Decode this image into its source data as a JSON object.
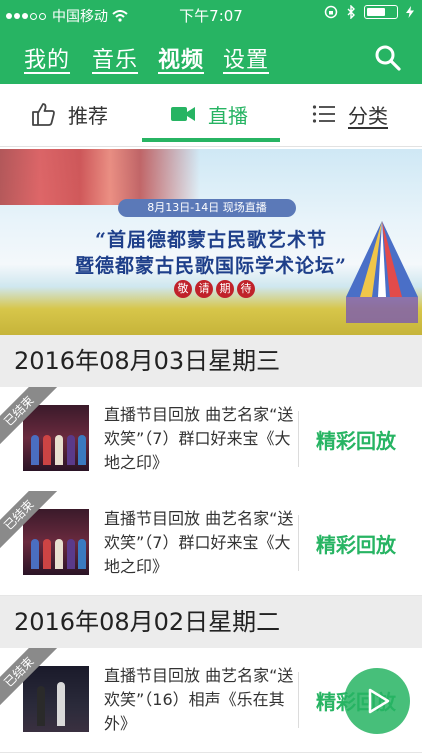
{
  "status": {
    "carrier": "中国移动",
    "time": "下午7:07"
  },
  "nav": {
    "tabs": [
      "我的",
      "音乐",
      "视频",
      "设置"
    ],
    "active": "视频"
  },
  "segments": [
    {
      "label": "推荐",
      "icon": "thumbs-up-icon"
    },
    {
      "label": "直播",
      "icon": "video-camera-icon"
    },
    {
      "label": "分类",
      "icon": "list-icon"
    }
  ],
  "banner": {
    "date": "8月13日-14日 现场直播",
    "line1": "“首届德都蒙古民歌艺术节",
    "line2": "暨德都蒙古民歌国际学术论坛”",
    "seal": [
      "敬",
      "请",
      "期",
      "待"
    ]
  },
  "sections": [
    {
      "date": "2016年08月03日星期三",
      "items": [
        {
          "badge": "已结束",
          "title": "直播节目回放 曲艺名家“送欢笑”（7）群口好来宝《大地之印》",
          "action": "精彩回放"
        },
        {
          "badge": "已结束",
          "title": "直播节目回放 曲艺名家“送欢笑”（7）群口好来宝《大地之印》",
          "action": "精彩回放"
        }
      ]
    },
    {
      "date": "2016年08月02日星期二",
      "items": [
        {
          "badge": "已结束",
          "title": "直播节目回放 曲艺名家“送欢笑”（16）相声《乐在其外》",
          "action": "精彩回放"
        }
      ]
    }
  ],
  "colors": {
    "accent": "#27b463"
  }
}
